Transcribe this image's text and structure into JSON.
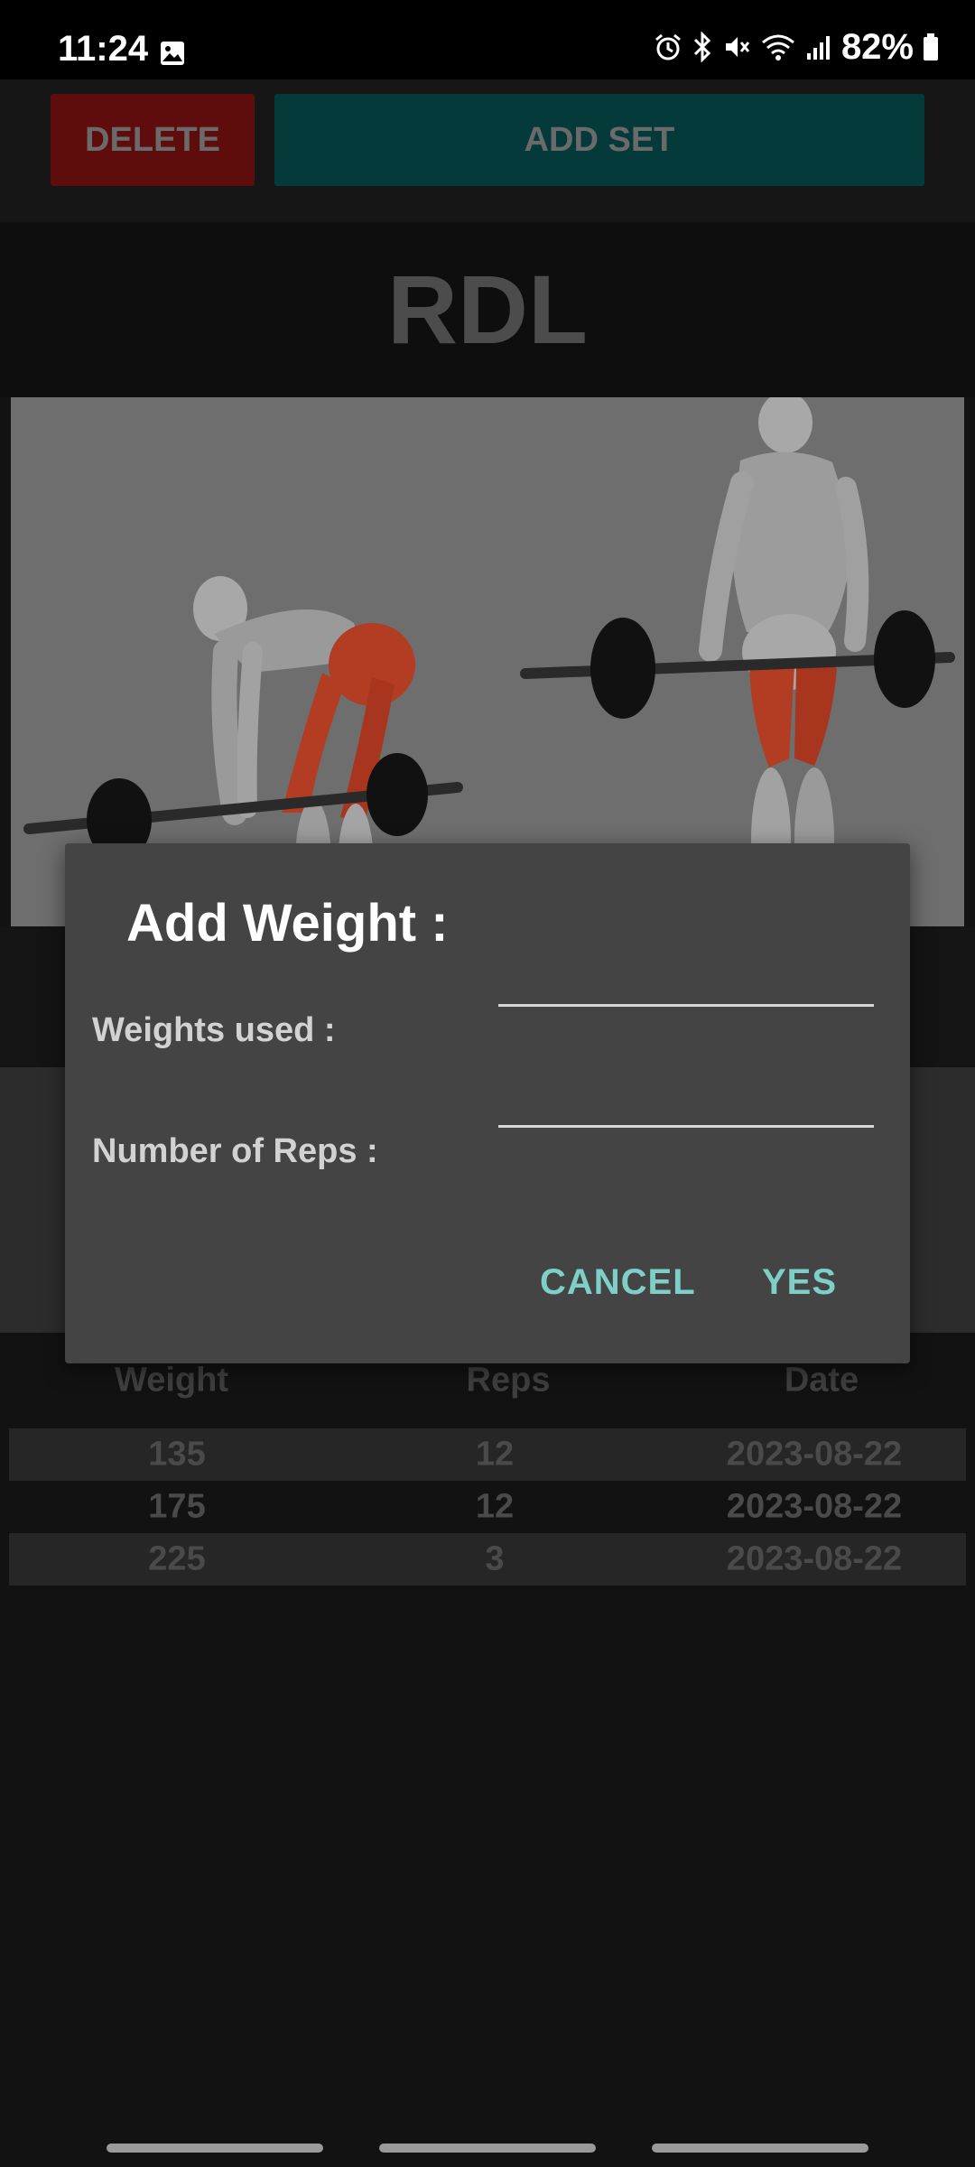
{
  "status_bar": {
    "time": "11:24",
    "battery": "82%",
    "icons": [
      "gallery-icon",
      "alarm-icon",
      "bluetooth-icon",
      "mute-icon",
      "wifi-icon",
      "signal-icon",
      "battery-icon"
    ]
  },
  "toolbar": {
    "delete_label": "DELETE",
    "add_set_label": "ADD SET"
  },
  "exercise": {
    "title": "RDL"
  },
  "history": {
    "headers": {
      "weight": "Weight",
      "reps": "Reps",
      "date": "Date"
    },
    "rows": [
      {
        "weight": "135",
        "reps": "12",
        "date": "2023-08-22"
      },
      {
        "weight": "175",
        "reps": "12",
        "date": "2023-08-22"
      },
      {
        "weight": "225",
        "reps": "3",
        "date": "2023-08-22"
      }
    ]
  },
  "dialog": {
    "title": "Add Weight :",
    "weights_label": "Weights used :",
    "weights_value": "",
    "reps_label": "Number of Reps :",
    "reps_value": "",
    "cancel_label": "CANCEL",
    "yes_label": "YES"
  },
  "colors": {
    "delete_button": "#5f0c0c",
    "add_set_button": "#053a3a",
    "dialog_background": "#444444",
    "dialog_action": "#7ecfc8",
    "muscle_highlight": "#b23d22"
  }
}
